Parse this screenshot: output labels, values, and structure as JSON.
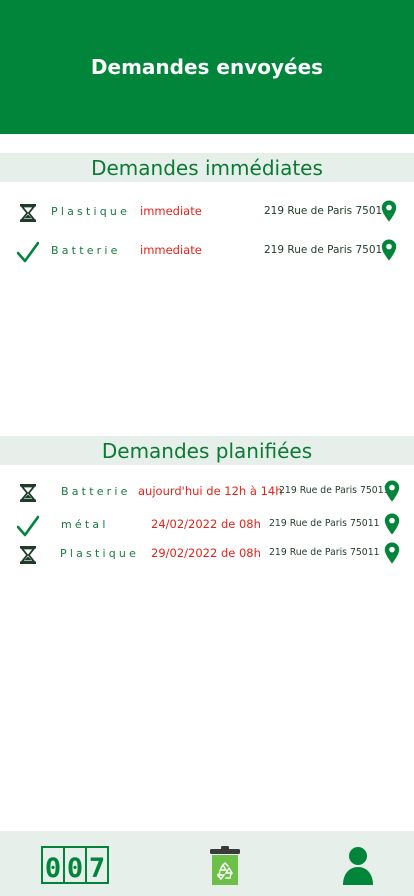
{
  "header": {
    "title": "Demandes envoyées"
  },
  "immediate": {
    "title": "Demandes immédiates",
    "rows": [
      {
        "status_icon": "hourglass-icon",
        "material": "Plastique",
        "timing": "immediate",
        "address": "219 Rue de Paris 75011"
      },
      {
        "status_icon": "check-icon",
        "material": "Batterie",
        "timing": "immediate",
        "address": "219 Rue de Paris 75011"
      }
    ]
  },
  "planned": {
    "title": "Demandes planifiées",
    "rows": [
      {
        "status_icon": "hourglass-icon",
        "material": "Batterie",
        "timing": "aujourd'hui de 12h à 14h",
        "address": "219 Rue de Paris 75011"
      },
      {
        "status_icon": "check-icon",
        "material": "métal",
        "timing": "24/02/2022 de 08h",
        "address": "219 Rue de Paris 75011"
      },
      {
        "status_icon": "hourglass-icon",
        "material": "Plastique",
        "timing": "29/02/2022 de 08h",
        "address": "219 Rue de Paris 75011"
      }
    ]
  },
  "bottom_nav": {
    "counter_digits": [
      "0",
      "0",
      "7"
    ],
    "items": [
      "counter-icon",
      "recycle-bin-icon",
      "user-icon"
    ]
  },
  "colors": {
    "primary": "#01853a",
    "section_bg": "#e6efe9",
    "timing_red": "#e3241b",
    "light_green": "#6cc04a"
  }
}
